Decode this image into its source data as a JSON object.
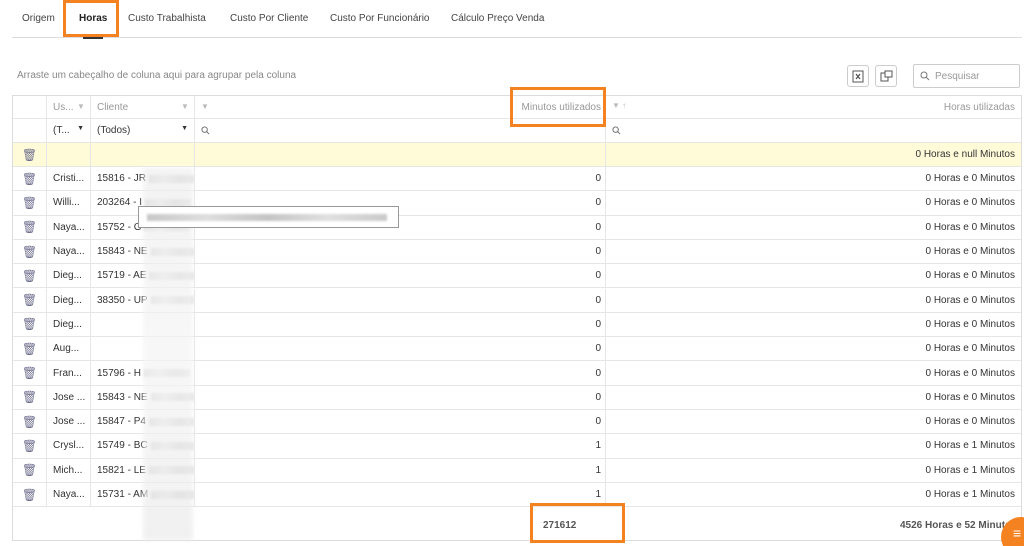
{
  "tabs": [
    {
      "label": "Origem"
    },
    {
      "label": "Horas"
    },
    {
      "label": "Custo Trabalhista"
    },
    {
      "label": "Custo Por Cliente"
    },
    {
      "label": "Custo Por Funcionário"
    },
    {
      "label": "Cálculo Preço Venda"
    }
  ],
  "active_tab": "Horas",
  "group_panel_text": "Arraste um cabeçalho de coluna aqui para agrupar pela coluna",
  "search": {
    "placeholder": "Pesquisar",
    "value": ""
  },
  "toolbar": {
    "excel_icon": "excel-export-icon",
    "columns_icon": "column-chooser-icon"
  },
  "columns": {
    "usuario": "Us...",
    "cliente": "Cliente",
    "minutos": "Minutos utilizados",
    "horas": "Horas utilizadas"
  },
  "filters": {
    "usuario": "(T...",
    "cliente": "(Todos)"
  },
  "summary_row": {
    "horas": "0 Horas e null Minutos"
  },
  "rows": [
    {
      "usuario": "Cristi...",
      "cliente": "15816 - JR",
      "minutos": "0",
      "horas": "0 Horas e 0 Minutos"
    },
    {
      "usuario": "Willi...",
      "cliente": "203264 - I",
      "minutos": "0",
      "horas": "0 Horas e 0 Minutos"
    },
    {
      "usuario": "Naya...",
      "cliente": "15752 - G",
      "minutos": "0",
      "horas": "0 Horas e 0 Minutos"
    },
    {
      "usuario": "Naya...",
      "cliente": "15843 - NE",
      "minutos": "0",
      "horas": "0 Horas e 0 Minutos"
    },
    {
      "usuario": "Dieg...",
      "cliente": "15719 - AE",
      "minutos": "0",
      "horas": "0 Horas e 0 Minutos"
    },
    {
      "usuario": "Dieg...",
      "cliente": "38350 - UP",
      "minutos": "0",
      "horas": "0 Horas e 0 Minutos"
    },
    {
      "usuario": "Dieg...",
      "cliente": "",
      "minutos": "0",
      "horas": "0 Horas e 0 Minutos"
    },
    {
      "usuario": "Aug...",
      "cliente": "",
      "minutos": "0",
      "horas": "0 Horas e 0 Minutos"
    },
    {
      "usuario": "Fran...",
      "cliente": "15796 - H",
      "minutos": "0",
      "horas": "0 Horas e 0 Minutos"
    },
    {
      "usuario": "Jose ...",
      "cliente": "15843 - NE",
      "minutos": "0",
      "horas": "0 Horas e 0 Minutos"
    },
    {
      "usuario": "Jose ...",
      "cliente": "15847 - P4",
      "minutos": "0",
      "horas": "0 Horas e 0 Minutos"
    },
    {
      "usuario": "Crysl...",
      "cliente": "15749 - BC",
      "minutos": "1",
      "horas": "0 Horas e 1 Minutos"
    },
    {
      "usuario": "Mich...",
      "cliente": "15821 - LE",
      "minutos": "1",
      "horas": "0 Horas e 1 Minutos"
    },
    {
      "usuario": "Naya...",
      "cliente": "15731 - AM",
      "minutos": "1",
      "horas": "0 Horas e 1 Minutos"
    }
  ],
  "totals": {
    "minutos": "271612",
    "horas": "4526 Horas e 52 Minutos"
  },
  "colors": {
    "accent": "#f58220",
    "summary_row_bg": "#fffbd9"
  }
}
